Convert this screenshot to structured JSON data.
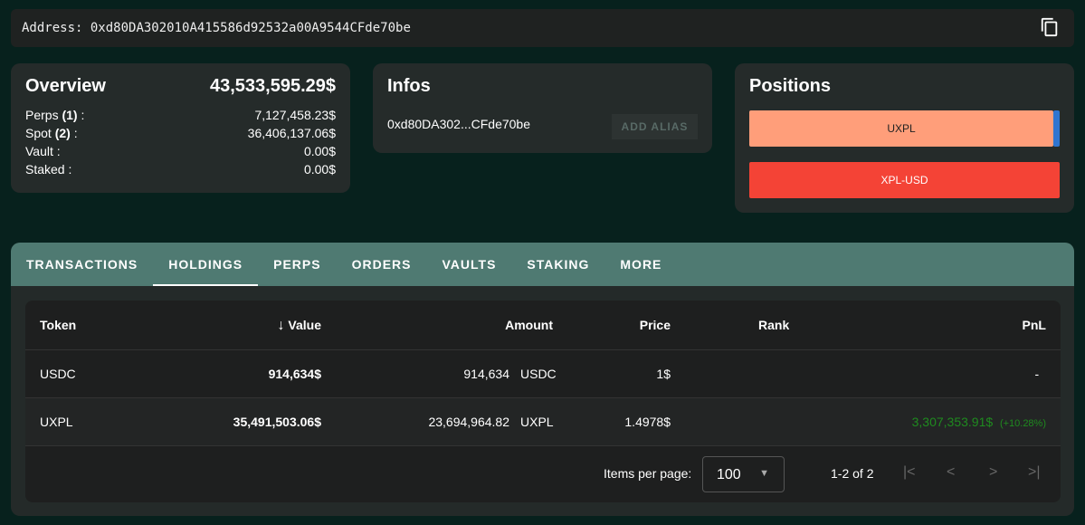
{
  "address": {
    "label": "Address:",
    "value": "0xd80DA302010A415586d92532a00A9544CFde70be"
  },
  "overview": {
    "title": "Overview",
    "total": "43,533,595.29$",
    "rows": [
      {
        "label": "Perps",
        "count": "(1)",
        "value": "7,127,458.23$"
      },
      {
        "label": "Spot",
        "count": "(2)",
        "value": "36,406,137.06$"
      },
      {
        "label": "Vault",
        "count": "",
        "value": "0.00$"
      },
      {
        "label": "Staked",
        "count": "",
        "value": "0.00$"
      }
    ]
  },
  "infos": {
    "title": "Infos",
    "short_address": "0xd80DA302...CFde70be",
    "add_alias": "ADD ALIAS"
  },
  "positions": {
    "title": "Positions",
    "items": [
      {
        "label": "UXPL",
        "color": "#ff9e7a"
      },
      {
        "label": "XPL-USD",
        "color": "#f44336"
      }
    ]
  },
  "tabs": [
    "TRANSACTIONS",
    "HOLDINGS",
    "PERPS",
    "ORDERS",
    "VAULTS",
    "STAKING",
    "MORE"
  ],
  "active_tab": "HOLDINGS",
  "table": {
    "headers": {
      "token": "Token",
      "value": "Value",
      "amount": "Amount",
      "price": "Price",
      "rank": "Rank",
      "pnl": "PnL"
    },
    "rows": [
      {
        "token": "USDC",
        "value": "914,634$",
        "amount": "914,634",
        "unit": "USDC",
        "price": "1$",
        "rank": "",
        "pnl": "-",
        "pnl_pct": ""
      },
      {
        "token": "UXPL",
        "value": "35,491,503.06$",
        "amount": "23,694,964.82",
        "unit": "UXPL",
        "price": "1.4978$",
        "rank": "",
        "pnl": "3,307,353.91$",
        "pnl_pct": "(+10.28%)"
      }
    ]
  },
  "pagination": {
    "items_label": "Items per page:",
    "per_page": "100",
    "range": "1-2 of 2"
  }
}
